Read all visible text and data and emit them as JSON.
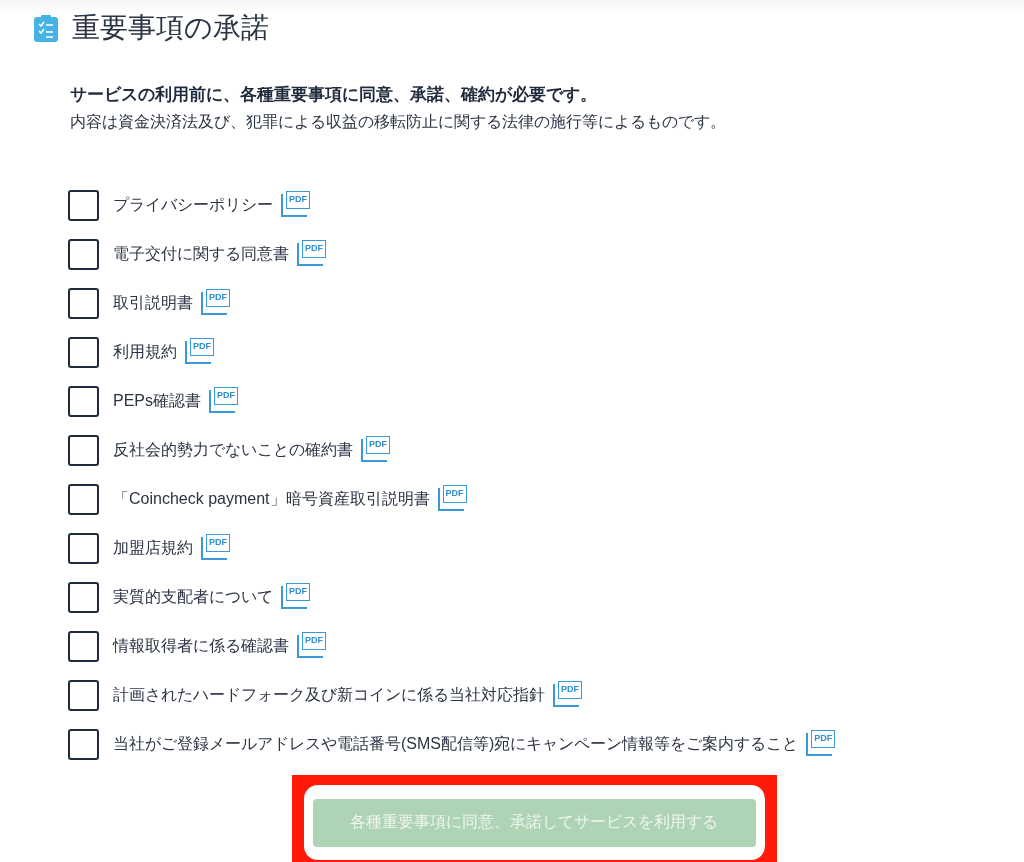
{
  "header": {
    "title": "重要事項の承諾"
  },
  "intro": {
    "lead": "サービスの利用前に、各種重要事項に同意、承諾、確約が必要です。",
    "note": "内容は資金決済法及び、犯罪による収益の移転防止に関する法律の施行等によるものです。"
  },
  "agreements": [
    {
      "label": "プライバシーポリシー",
      "checked": false,
      "doc": "PDF"
    },
    {
      "label": "電子交付に関する同意書",
      "checked": false,
      "doc": "PDF"
    },
    {
      "label": "取引説明書",
      "checked": false,
      "doc": "PDF"
    },
    {
      "label": "利用規約",
      "checked": false,
      "doc": "PDF"
    },
    {
      "label": "PEPs確認書",
      "checked": false,
      "doc": "PDF"
    },
    {
      "label": "反社会的勢力でないことの確約書",
      "checked": false,
      "doc": "PDF"
    },
    {
      "label": "「Coincheck payment」暗号資産取引説明書",
      "checked": false,
      "doc": "PDF"
    },
    {
      "label": "加盟店規約",
      "checked": false,
      "doc": "PDF"
    },
    {
      "label": "実質的支配者について",
      "checked": false,
      "doc": "PDF"
    },
    {
      "label": "情報取得者に係る確認書",
      "checked": false,
      "doc": "PDF"
    },
    {
      "label": "計画されたハードフォーク及び新コインに係る当社対応指針",
      "checked": false,
      "doc": "PDF"
    },
    {
      "label": "当社がご登録メールアドレスや電話番号(SMS配信等)宛にキャンペーン情報等をご案内すること",
      "checked": false,
      "doc": "PDF"
    }
  ],
  "submit": {
    "label": "各種重要事項に同意、承諾してサービスを利用する",
    "disabled": true,
    "highlighted": true
  }
}
